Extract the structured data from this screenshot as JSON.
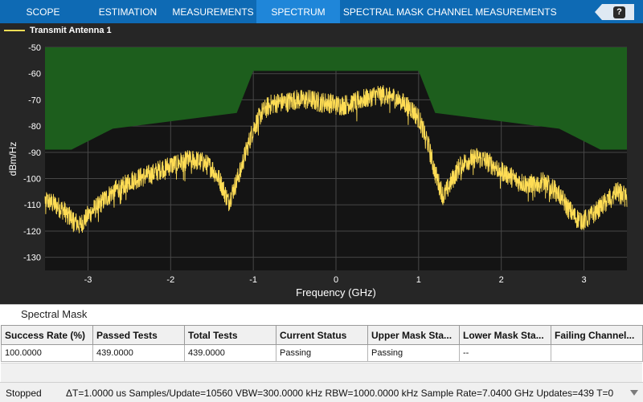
{
  "toolstrip": {
    "tabs": [
      {
        "label": "SCOPE",
        "active": false
      },
      {
        "label": "ESTIMATION",
        "active": false
      },
      {
        "label": "MEASUREMENTS",
        "active": false
      },
      {
        "label": "SPECTRUM",
        "active": true
      },
      {
        "label": "SPECTRAL MASK",
        "active": false
      },
      {
        "label": "CHANNEL MEASUREMENTS",
        "active": false
      }
    ],
    "help_label": "?"
  },
  "legend": {
    "label": "Transmit Antenna 1"
  },
  "colors": {
    "trace": "#ffdd55",
    "mask": "#1d5e1d",
    "axes_bg": "#141414",
    "panel_bg": "#262626",
    "grid": "#474747"
  },
  "chart_data": {
    "type": "line",
    "xlabel": "Frequency (GHz)",
    "ylabel": "dBm/Hz",
    "xlim": [
      -3.52,
      3.52
    ],
    "ylim": [
      -135,
      -50
    ],
    "xticks": [
      -3,
      -2,
      -1,
      0,
      1,
      2,
      3
    ],
    "yticks": [
      -50,
      -60,
      -70,
      -80,
      -90,
      -100,
      -110,
      -120,
      -130
    ],
    "grid": true,
    "legend_position": "top-left",
    "series": [
      {
        "name": "Transmit Antenna 1",
        "x": [
          -3.52,
          -3.4,
          -3.3,
          -3.2,
          -3.1,
          -3.0,
          -2.9,
          -2.8,
          -2.7,
          -2.6,
          -2.5,
          -2.4,
          -2.3,
          -2.2,
          -2.1,
          -2.0,
          -1.9,
          -1.8,
          -1.7,
          -1.6,
          -1.5,
          -1.4,
          -1.3,
          -1.2,
          -1.1,
          -1.0,
          -0.9,
          -0.8,
          -0.7,
          -0.6,
          -0.5,
          -0.4,
          -0.3,
          -0.2,
          -0.1,
          0.0,
          0.1,
          0.2,
          0.3,
          0.4,
          0.5,
          0.6,
          0.7,
          0.8,
          0.9,
          1.0,
          1.1,
          1.2,
          1.3,
          1.4,
          1.5,
          1.6,
          1.7,
          1.8,
          1.9,
          2.0,
          2.1,
          2.2,
          2.3,
          2.4,
          2.5,
          2.6,
          2.7,
          2.8,
          2.9,
          3.0,
          3.1,
          3.2,
          3.3,
          3.4,
          3.52
        ],
        "y": [
          -107,
          -109,
          -111,
          -114,
          -117,
          -113,
          -110,
          -107,
          -104,
          -102,
          -100,
          -99,
          -98,
          -97,
          -95,
          -94,
          -93,
          -92,
          -92,
          -93,
          -95,
          -100,
          -108,
          -100,
          -90,
          -80,
          -74,
          -71,
          -70,
          -70,
          -69,
          -69,
          -69,
          -70,
          -70,
          -71,
          -71,
          -70,
          -69,
          -68,
          -67,
          -67,
          -68,
          -70,
          -72,
          -76,
          -84,
          -97,
          -106,
          -100,
          -94,
          -92,
          -91,
          -92,
          -94,
          -96,
          -98,
          -100,
          -101,
          -101,
          -100,
          -102,
          -105,
          -110,
          -114,
          -115,
          -113,
          -110,
          -107,
          -104,
          -106
        ]
      }
    ],
    "mask": {
      "upper_x": [
        -3.52,
        -3.2,
        -2.7,
        -1.2,
        -1.0,
        1.0,
        1.2,
        2.7,
        3.2,
        3.52
      ],
      "upper_y": [
        -89,
        -89,
        -81,
        -75,
        -59,
        -59,
        -75,
        -81,
        -89,
        -89
      ]
    }
  },
  "spectral_mask": {
    "title": "Spectral Mask",
    "columns": [
      "Success Rate (%)",
      "Passed Tests",
      "Total Tests",
      "Current Status",
      "Upper Mask Sta...",
      "Lower Mask Sta...",
      "Failing Channel..."
    ],
    "rows": [
      [
        "100.0000",
        "439.0000",
        "439.0000",
        "Passing",
        "Passing",
        "--",
        ""
      ]
    ]
  },
  "status": {
    "left": "Stopped",
    "right": "ΔT=1.0000 us  Samples/Update=10560  VBW=300.0000 kHz  RBW=1000.0000 kHz  Sample Rate=7.0400 GHz  Updates=439  T=0"
  }
}
